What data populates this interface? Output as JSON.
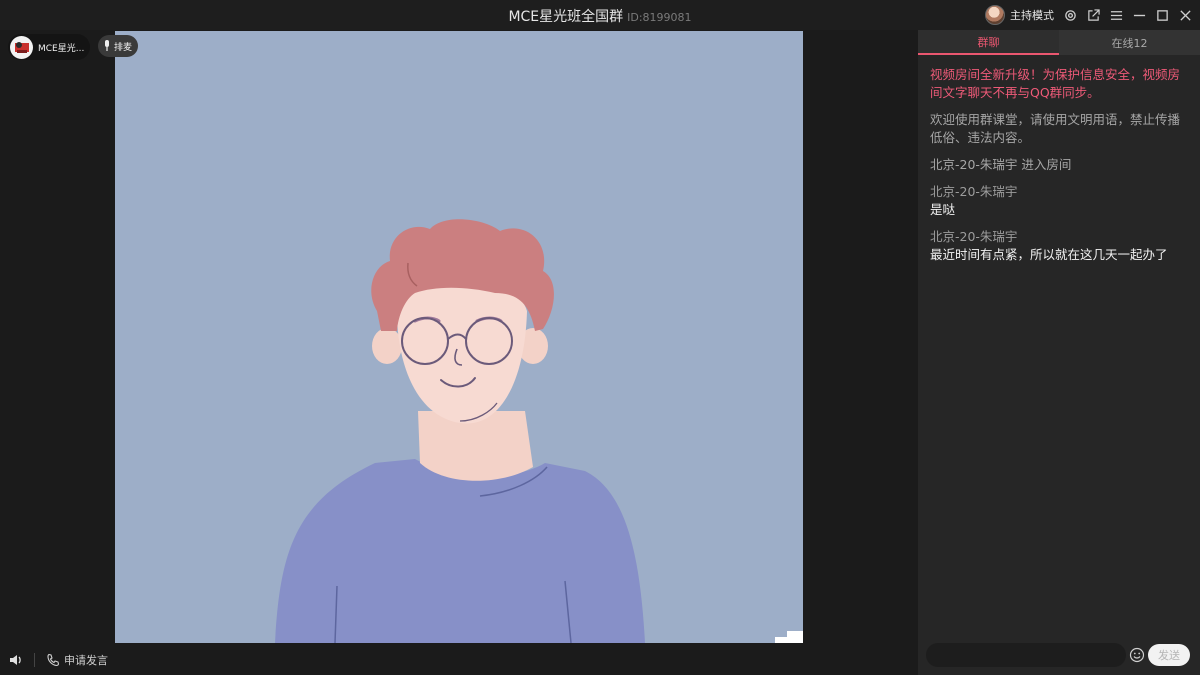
{
  "window": {
    "title": "MCE星光班全国群",
    "room_id": "ID:8199081",
    "host_mode_label": "主持模式",
    "controls": [
      "gear-icon",
      "share-icon",
      "menu-icon",
      "minimize-icon",
      "maximize-icon",
      "close-icon"
    ]
  },
  "video": {
    "room_chip_label": "MCE星光...",
    "queue_label": "排麦"
  },
  "bottom_bar": {
    "apply_label": "申请发言"
  },
  "chat": {
    "tabs": [
      {
        "label": "群聊",
        "active": true
      },
      {
        "label": "在线12",
        "active": false
      }
    ],
    "notice": "视频房间全新升级！为保护信息安全，视频房间文字聊天不再与QQ群同步。",
    "system": "欢迎使用群课堂，请使用文明用语，禁止传播低俗、违法内容。",
    "enter": "北京-20-朱瑞宇 进入房间",
    "messages": [
      {
        "sender": "北京-20-朱瑞宇",
        "text": "是哒"
      },
      {
        "sender": "北京-20-朱瑞宇",
        "text": "最近时间有点紧，所以就在这几天一起办了"
      }
    ],
    "input_placeholder": "",
    "send_label": "发送"
  },
  "colors": {
    "accent": "#ea5770",
    "video_bg": "#9daec8",
    "panel_bg": "#262626"
  }
}
